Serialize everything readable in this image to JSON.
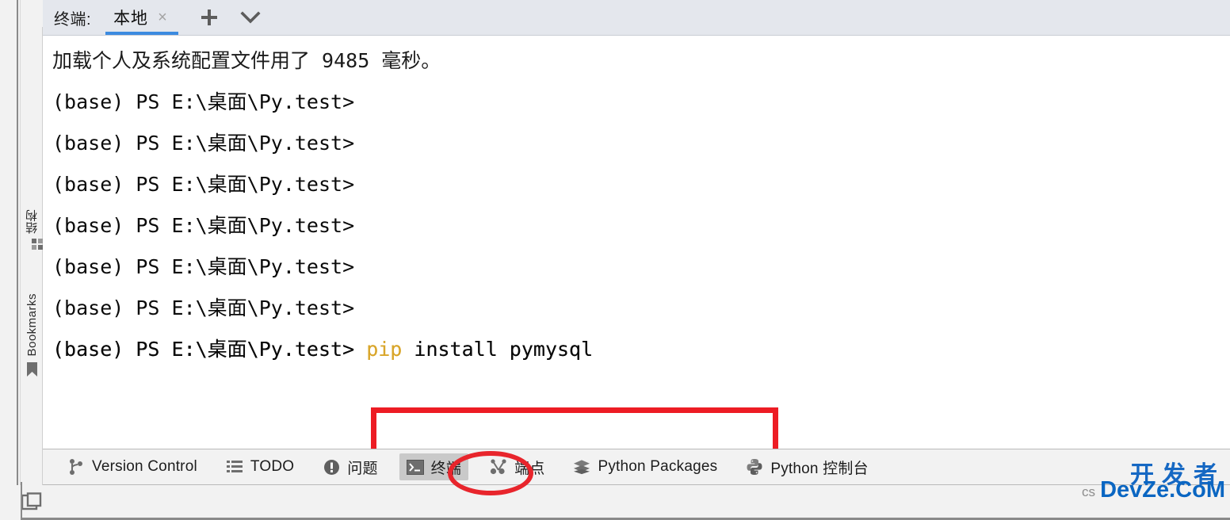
{
  "window": {
    "app": "PyCharm Terminal"
  },
  "rail": {
    "items": [
      {
        "label": "结构",
        "icon": "grid-icon"
      },
      {
        "label": "Bookmarks",
        "icon": "bookmark-icon"
      }
    ],
    "layout_icon": "layout-windows-icon"
  },
  "tabbar": {
    "title": "终端:",
    "tabs": [
      {
        "label": "本地",
        "active": true,
        "close": "×"
      }
    ],
    "new_tab_icon": "plus-icon",
    "dropdown_icon": "chevron-down-icon"
  },
  "terminal": {
    "lines": [
      {
        "text": "加载个人及系统配置文件用了 9485 毫秒。"
      },
      {
        "text": "(base) PS E:\\桌面\\Py.test>"
      },
      {
        "text": "(base) PS E:\\桌面\\Py.test>"
      },
      {
        "text": "(base) PS E:\\桌面\\Py.test>"
      },
      {
        "text": "(base) PS E:\\桌面\\Py.test>"
      },
      {
        "text": "(base) PS E:\\桌面\\Py.test>"
      },
      {
        "text": "(base) PS E:\\桌面\\Py.test>"
      },
      {
        "text": "(base) PS E:\\桌面\\Py.test>"
      }
    ],
    "command_line": {
      "prompt": "(base) PS E:\\桌面\\Py.test> ",
      "command_keyword": "pip",
      "command_rest": " install pymysql",
      "full": "(base) PS E:\\桌面\\Py.test> pip install pymysql"
    }
  },
  "annotations": {
    "rect_color": "#ed1c24",
    "ellipse_color": "#e8252c",
    "rect_target": "pip install pymysql",
    "ellipse_target": "终端"
  },
  "toolwindows": {
    "items": [
      {
        "label": "Version Control",
        "icon": "branch-icon",
        "active": false
      },
      {
        "label": "TODO",
        "icon": "list-icon",
        "active": false
      },
      {
        "label": "问题",
        "icon": "warning-circle-icon",
        "active": false
      },
      {
        "label": "终端",
        "icon": "terminal-icon",
        "active": true
      },
      {
        "label": "端点",
        "icon": "endpoints-icon",
        "active": false
      },
      {
        "label": "Python Packages",
        "icon": "packages-icon",
        "active": false
      },
      {
        "label": "Python 控制台",
        "icon": "python-icon",
        "active": false
      }
    ]
  },
  "watermark": {
    "top": "开发者",
    "prefix": "cs",
    "bottom": "DevZe.CoM"
  },
  "colors": {
    "accent_blue": "#3c8be0",
    "tabbar_bg": "#e4e7ed",
    "toolbar_bg": "#f2f2f2",
    "terminal_bg": "#ffffff",
    "command_keyword": "#d9a62b"
  }
}
